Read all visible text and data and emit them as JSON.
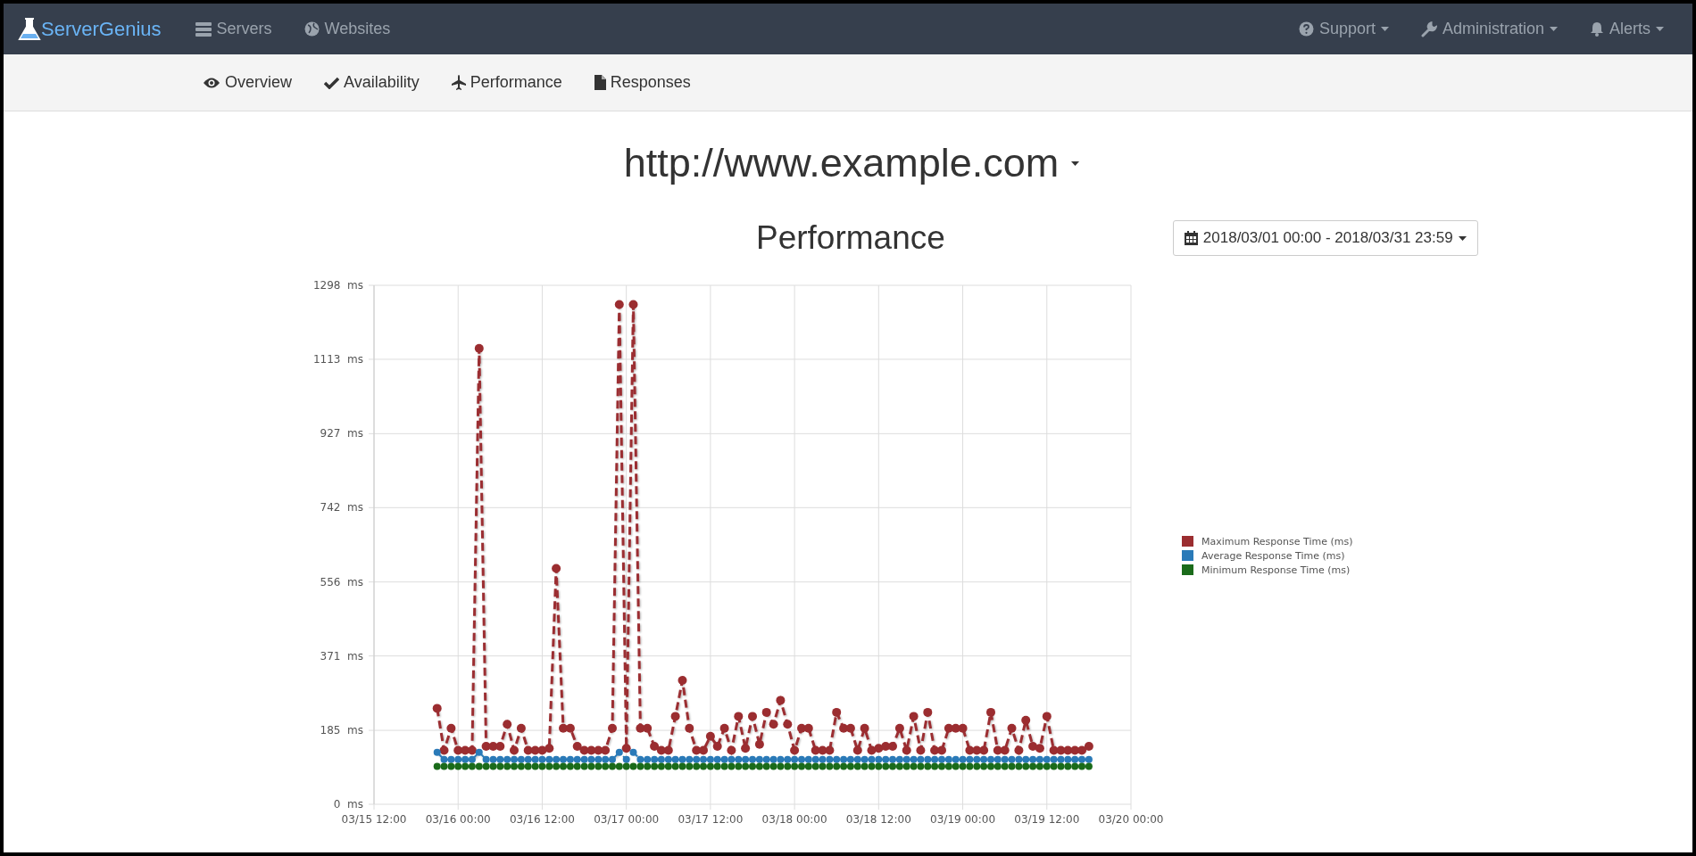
{
  "navbar": {
    "brand": "ServerGenius",
    "left_items": [
      {
        "label": "Servers"
      },
      {
        "label": "Websites"
      }
    ],
    "right_items": [
      {
        "label": "Support",
        "has_menu": true
      },
      {
        "label": "Administration",
        "has_menu": true
      },
      {
        "label": "Alerts",
        "has_menu": true
      }
    ]
  },
  "subnav": {
    "tabs": [
      {
        "label": "Overview"
      },
      {
        "label": "Availability"
      },
      {
        "label": "Performance"
      },
      {
        "label": "Responses"
      }
    ]
  },
  "site": {
    "url": "http://www.example.com",
    "has_menu": true
  },
  "performance": {
    "title": "Performance",
    "date_range": {
      "label": "2018/03/01 00:00 - 2018/03/31 23:59",
      "has_menu": true
    },
    "chart_data": {
      "type": "line",
      "grid": true,
      "ylim": [
        0,
        1298
      ],
      "categories": [
        "03/15 12:00",
        null,
        null,
        null,
        null,
        null,
        null,
        null,
        null,
        null,
        null,
        null,
        "03/16 00:00",
        null,
        null,
        null,
        null,
        null,
        null,
        null,
        null,
        null,
        null,
        null,
        "03/16 12:00",
        null,
        null,
        null,
        null,
        null,
        null,
        null,
        null,
        null,
        null,
        null,
        "03/17 00:00",
        null,
        null,
        null,
        null,
        null,
        null,
        null,
        null,
        null,
        null,
        null,
        "03/17 12:00",
        null,
        null,
        null,
        null,
        null,
        null,
        null,
        null,
        null,
        null,
        null,
        "03/18 00:00",
        null,
        null,
        null,
        null,
        null,
        null,
        null,
        null,
        null,
        null,
        null,
        "03/18 12:00",
        null,
        null,
        null,
        null,
        null,
        null,
        null,
        null,
        null,
        null,
        null,
        "03/19 00:00",
        null,
        null,
        null,
        null,
        null,
        null,
        null,
        null,
        null,
        null,
        null,
        "03/19 12:00",
        null,
        null,
        null,
        null,
        null,
        null,
        null,
        null,
        null,
        null,
        null,
        "03/20 00:00"
      ],
      "yticks": [
        {
          "value": 0,
          "label": "0  ms"
        },
        {
          "value": 185,
          "label": "185  ms"
        },
        {
          "value": 371,
          "label": "371  ms"
        },
        {
          "value": 556,
          "label": "556  ms"
        },
        {
          "value": 742,
          "label": "742  ms"
        },
        {
          "value": 927,
          "label": "927  ms"
        },
        {
          "value": 1113,
          "label": "1113  ms"
        },
        {
          "value": 1298,
          "label": "1298  ms"
        }
      ],
      "series": [
        {
          "name": "Maximum Response Time (ms)",
          "color": "#9b2d30",
          "line_style": "dashed",
          "marker": "circle",
          "values": [
            null,
            null,
            null,
            null,
            null,
            null,
            null,
            null,
            null,
            240,
            135,
            190,
            135,
            135,
            135,
            1140,
            145,
            145,
            145,
            200,
            135,
            190,
            135,
            135,
            135,
            140,
            590,
            190,
            190,
            145,
            135,
            135,
            135,
            135,
            190,
            1250,
            140,
            1250,
            190,
            190,
            145,
            135,
            135,
            220,
            310,
            190,
            135,
            135,
            170,
            145,
            190,
            135,
            220,
            140,
            220,
            150,
            230,
            200,
            260,
            200,
            135,
            190,
            190,
            135,
            135,
            135,
            230,
            190,
            190,
            135,
            190,
            135,
            140,
            145,
            145,
            190,
            135,
            220,
            135,
            230,
            135,
            135,
            190,
            190,
            190,
            135,
            135,
            135,
            230,
            135,
            135,
            190,
            135,
            210,
            145,
            140,
            220,
            135,
            135,
            135,
            135,
            135,
            145,
            null,
            null,
            null,
            null,
            null,
            null
          ]
        },
        {
          "name": "Average Response Time (ms)",
          "color": "#2a7ab8",
          "line_style": "dashed",
          "marker": "circle",
          "values": [
            null,
            null,
            null,
            null,
            null,
            null,
            null,
            null,
            null,
            130,
            112,
            112,
            112,
            112,
            112,
            130,
            112,
            112,
            112,
            112,
            112,
            112,
            112,
            112,
            112,
            112,
            112,
            112,
            112,
            112,
            112,
            112,
            112,
            112,
            112,
            130,
            112,
            130,
            112,
            112,
            112,
            112,
            112,
            112,
            112,
            112,
            112,
            112,
            112,
            112,
            112,
            112,
            112,
            112,
            112,
            112,
            112,
            112,
            112,
            112,
            112,
            112,
            112,
            112,
            112,
            112,
            112,
            112,
            112,
            112,
            112,
            112,
            112,
            112,
            112,
            112,
            112,
            112,
            112,
            112,
            112,
            112,
            112,
            112,
            112,
            112,
            112,
            112,
            112,
            112,
            112,
            112,
            112,
            112,
            112,
            112,
            112,
            112,
            112,
            112,
            112,
            112,
            112,
            null,
            null,
            null,
            null,
            null,
            null
          ]
        },
        {
          "name": "Minimum Response Time (ms)",
          "color": "#1a6b1a",
          "line_style": "dashed",
          "marker": "circle",
          "values": [
            null,
            null,
            null,
            null,
            null,
            null,
            null,
            null,
            null,
            95,
            95,
            95,
            95,
            95,
            95,
            95,
            95,
            95,
            95,
            95,
            95,
            95,
            95,
            95,
            95,
            95,
            95,
            95,
            95,
            95,
            95,
            95,
            95,
            95,
            95,
            95,
            95,
            95,
            95,
            95,
            95,
            95,
            95,
            95,
            95,
            95,
            95,
            95,
            95,
            95,
            95,
            95,
            95,
            95,
            95,
            95,
            95,
            95,
            95,
            95,
            95,
            95,
            95,
            95,
            95,
            95,
            95,
            95,
            95,
            95,
            95,
            95,
            95,
            95,
            95,
            95,
            95,
            95,
            95,
            95,
            95,
            95,
            95,
            95,
            95,
            95,
            95,
            95,
            95,
            95,
            95,
            95,
            95,
            95,
            95,
            95,
            95,
            95,
            95,
            95,
            95,
            95,
            95,
            null,
            null,
            null,
            null,
            null,
            null
          ]
        }
      ]
    }
  }
}
